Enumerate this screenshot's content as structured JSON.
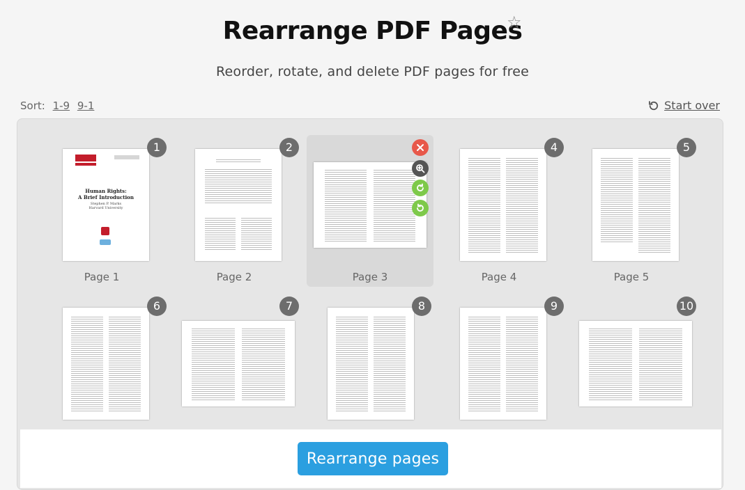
{
  "header": {
    "title": "Rearrange PDF Pages",
    "subtitle": "Reorder, rotate, and delete PDF pages for free",
    "favorite_icon": "star-outline-icon"
  },
  "sort": {
    "label": "Sort:",
    "options": [
      "1-9",
      "9-1"
    ]
  },
  "start_over": {
    "label": "Start over",
    "icon": "restart-icon"
  },
  "pages": [
    {
      "number": "1",
      "label": "Page 1"
    },
    {
      "number": "2",
      "label": "Page 2"
    },
    {
      "number": "",
      "label": "Page 3"
    },
    {
      "number": "4",
      "label": "Page 4"
    },
    {
      "number": "5",
      "label": "Page 5"
    },
    {
      "number": "6",
      "label": ""
    },
    {
      "number": "7",
      "label": ""
    },
    {
      "number": "8",
      "label": ""
    },
    {
      "number": "9",
      "label": ""
    },
    {
      "number": "10",
      "label": ""
    }
  ],
  "cover": {
    "title_line1": "Human Rights:",
    "title_line2": "A Brief Introduction",
    "author": "Stephen P. Marks",
    "affiliation": "Harvard University"
  },
  "page_actions": {
    "delete": "close-icon",
    "zoom": "zoom-in-icon",
    "rotate_right": "rotate-clockwise-icon",
    "rotate_left": "rotate-counterclockwise-icon"
  },
  "colors": {
    "primary_button": "#2b9fe0",
    "delete_action": "#e8584a",
    "rotate_action": "#7ec94a",
    "zoom_action": "#555555",
    "badge": "#6d6d6d"
  },
  "actions": {
    "rearrange_label": "Rearrange pages"
  }
}
